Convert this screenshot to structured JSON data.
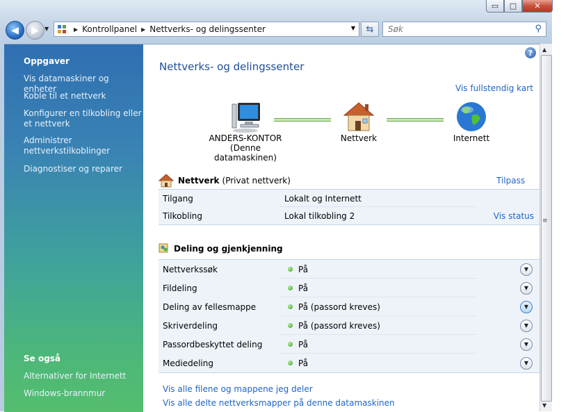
{
  "window": {
    "min_label": "▭",
    "max_label": "□",
    "close_label": "✕"
  },
  "nav": {
    "back_icon": "◀",
    "forward_icon": "▶",
    "breadcrumbs": [
      "Kontrollpanel",
      "Nettverks- og delingssenter"
    ],
    "search_placeholder": "Søk"
  },
  "sidebar": {
    "tasks_title": "Oppgaver",
    "tasks": [
      "Vis datamaskiner og enheter",
      "Koble til et nettverk",
      "Konfigurer en tilkobling eller et nettverk",
      "Administrer nettverkstilkoblinger",
      "Diagnostiser og reparer"
    ],
    "see_also_title": "Se også",
    "see_also": [
      "Alternativer for Internett",
      "Windows-brannmur"
    ]
  },
  "main": {
    "title": "Nettverks- og delingssenter",
    "full_map_link": "Vis fullstendig kart",
    "map": {
      "computer_name": "ANDERS-KONTOR",
      "computer_sub": "(Denne datamaskinen)",
      "network_label": "Nettverk",
      "internet_label": "Internett"
    },
    "network": {
      "name": "Nettverk",
      "type": "(Privat nettverk)",
      "customize_link": "Tilpass",
      "rows": [
        {
          "label": "Tilgang",
          "value": "Lokalt og Internett",
          "action": ""
        },
        {
          "label": "Tilkobling",
          "value": "Lokal tilkobling 2",
          "action": "Vis status"
        }
      ]
    },
    "sharing": {
      "title": "Deling og gjenkjenning",
      "rows": [
        {
          "label": "Nettverkssøk",
          "value": "På"
        },
        {
          "label": "Fildeling",
          "value": "På"
        },
        {
          "label": "Deling av fellesmappe",
          "value": "På (passord kreves)"
        },
        {
          "label": "Skriverdeling",
          "value": "På (passord kreves)"
        },
        {
          "label": "Passordbeskyttet deling",
          "value": "På"
        },
        {
          "label": "Mediedeling",
          "value": "På"
        }
      ]
    },
    "bottom_links": [
      "Vis alle filene og mappene jeg deler",
      "Vis alle delte nettverksmapper på denne datamaskinen"
    ]
  },
  "colors": {
    "link": "#1e64c8",
    "title": "#1e4d96",
    "status_on": "#2f9a1c"
  }
}
